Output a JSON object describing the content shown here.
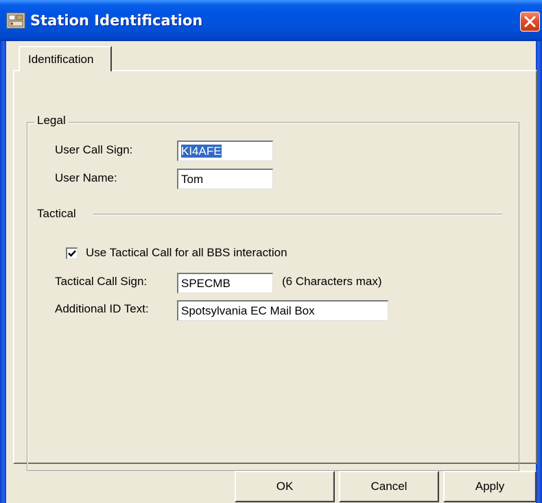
{
  "window": {
    "title": "Station Identification",
    "app_icon": "station-icon",
    "close_icon": "close-icon"
  },
  "tabs": [
    {
      "label": "Identification",
      "active": true
    }
  ],
  "legal": {
    "group_label": "Legal",
    "call_sign_label": "User Call Sign:",
    "call_sign_value": "KI4AFE",
    "user_name_label": "User Name:",
    "user_name_value": "Tom"
  },
  "tactical": {
    "section_label": "Tactical",
    "checkbox_label": "Use Tactical Call for all BBS interaction",
    "checkbox_checked": true,
    "call_sign_label": "Tactical Call Sign:",
    "call_sign_value": "SPECMB",
    "call_sign_hint": "(6 Characters max)",
    "additional_id_label": "Additional ID Text:",
    "additional_id_value": "Spotsylvania EC Mail Box"
  },
  "buttons": {
    "ok": "OK",
    "cancel": "Cancel",
    "apply": "Apply"
  },
  "colors": {
    "titlebar": "#0055e5",
    "dialog_bg": "#ece9d8",
    "selection": "#316ac5",
    "close_button": "#e0502a"
  }
}
